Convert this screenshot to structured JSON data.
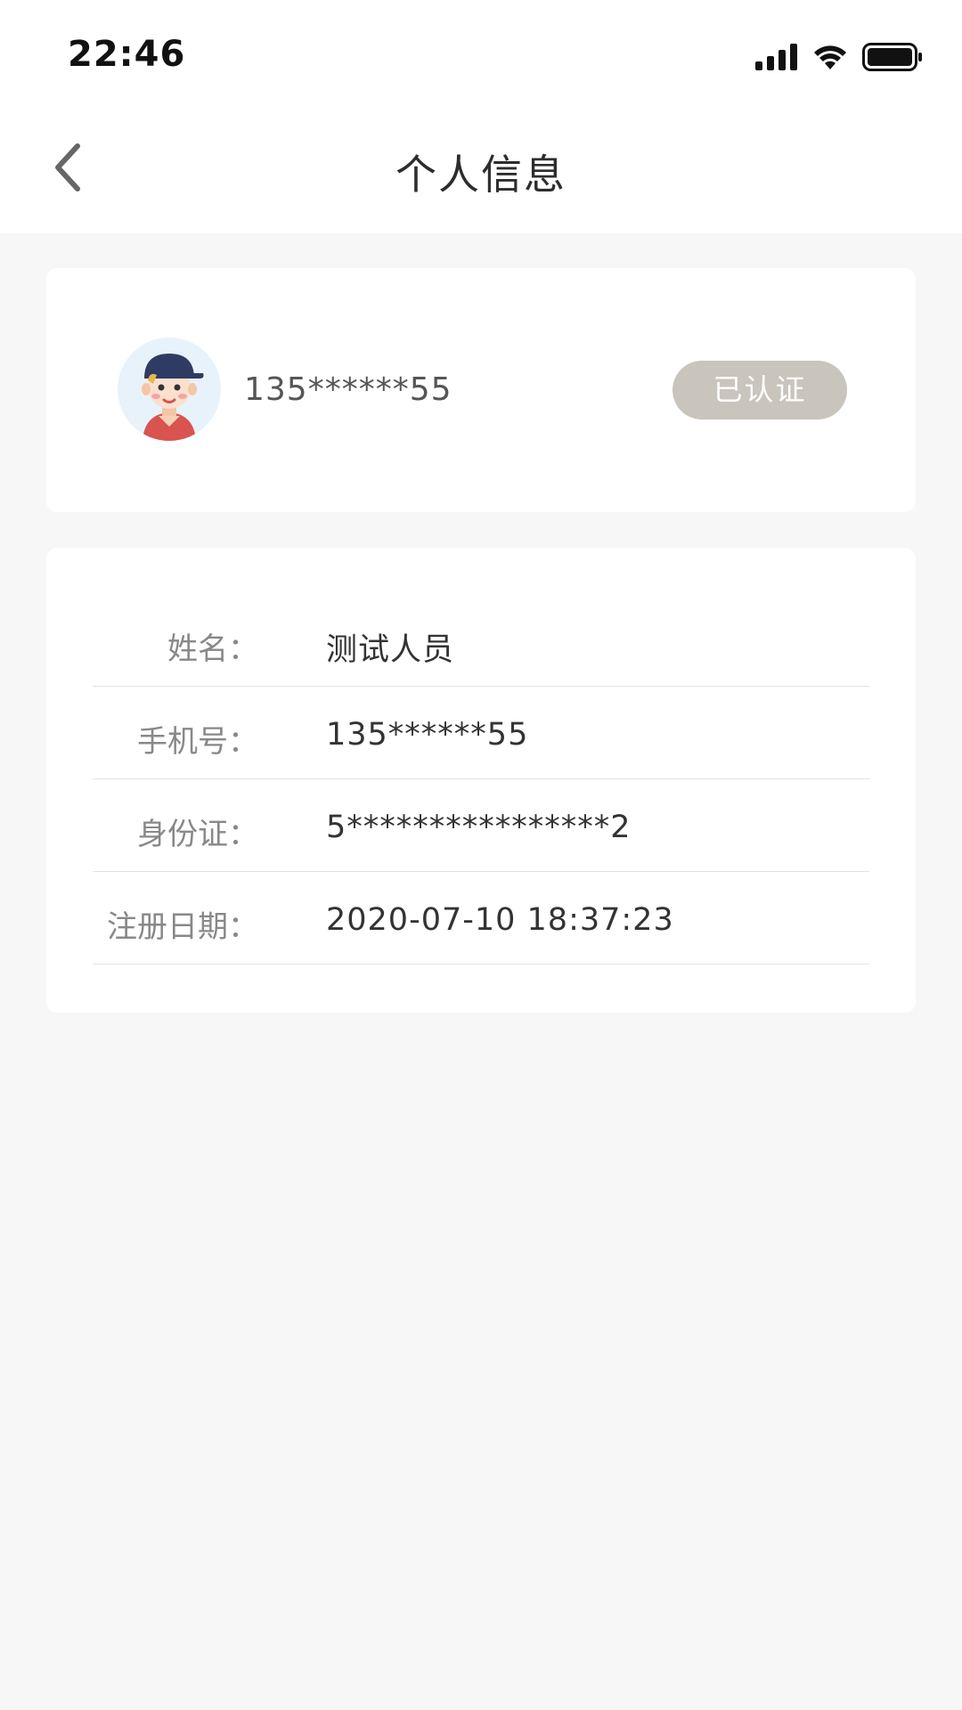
{
  "status_bar": {
    "time": "22:46"
  },
  "nav": {
    "title": "个人信息"
  },
  "profile": {
    "phone": "135******55",
    "badge": "已认证"
  },
  "info": [
    {
      "label": "姓名：",
      "value": "测试人员"
    },
    {
      "label": "手机号：",
      "value": "135******55"
    },
    {
      "label": "身份证：",
      "value": "5****************2"
    },
    {
      "label": "注册日期：",
      "value": "2020-07-10 18:37:23"
    }
  ],
  "colors": {
    "background": "#f7f7f7",
    "card": "#ffffff",
    "badge_bg": "#c9c4bc",
    "avatar_bg": "#e8f2fb"
  }
}
